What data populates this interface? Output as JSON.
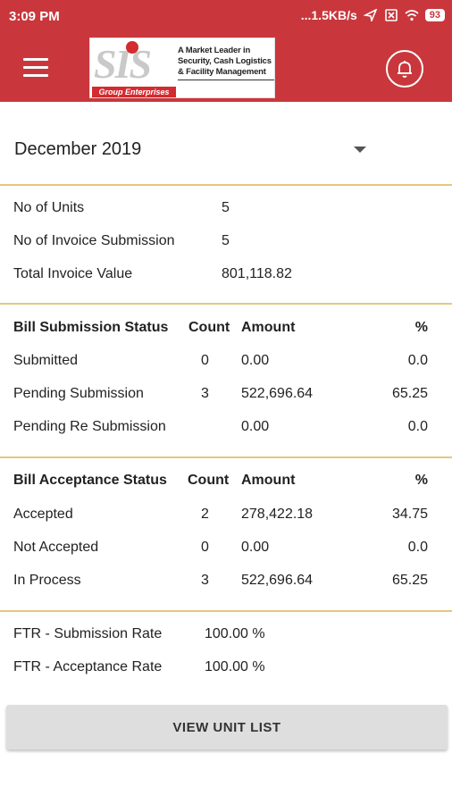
{
  "status_bar": {
    "time": "3:09 PM",
    "network_speed": "...1.5KB/s",
    "battery": "93"
  },
  "app_bar": {
    "logo_text": "SIS",
    "logo_group": "Group Enterprises",
    "logo_tagline": "A Market Leader in Security, Cash Logistics & Facility Management"
  },
  "month_selector": {
    "value": "December  2019"
  },
  "summary": [
    {
      "label": "No of Units",
      "value": "5"
    },
    {
      "label": "No of Invoice Submission",
      "value": "5"
    },
    {
      "label": "Total Invoice Value",
      "value": "801,118.82"
    }
  ],
  "bill_submission": {
    "headers": {
      "status": "Bill Submission Status",
      "count": "Count",
      "amount": "Amount",
      "percent": "%"
    },
    "rows": [
      {
        "status": "Submitted",
        "count": "0",
        "amount": "0.00",
        "percent": "0.0"
      },
      {
        "status": "Pending Submission",
        "count": "3",
        "amount": "522,696.64",
        "percent": "65.25"
      },
      {
        "status": "Pending Re Submission",
        "count": "",
        "amount": "0.00",
        "percent": "0.0"
      }
    ]
  },
  "bill_acceptance": {
    "headers": {
      "status": "Bill Acceptance  Status",
      "count": "Count",
      "amount": "Amount",
      "percent": "%"
    },
    "rows": [
      {
        "status": "Accepted",
        "count": "2",
        "amount": "278,422.18",
        "percent": "34.75"
      },
      {
        "status": "Not Accepted",
        "count": "0",
        "amount": "0.00",
        "percent": "0.0"
      },
      {
        "status": "In Process",
        "count": "3",
        "amount": "522,696.64",
        "percent": "65.25"
      }
    ]
  },
  "ftr": [
    {
      "label": "FTR - Submission Rate",
      "value": "100.00 %"
    },
    {
      "label": "FTR - Acceptance Rate",
      "value": "100.00 %"
    }
  ],
  "actions": {
    "view_unit_list": "VIEW UNIT LIST"
  },
  "colors": {
    "primary": "#c9373c",
    "divider": "#e4c97c",
    "button_bg": "#dedede"
  }
}
